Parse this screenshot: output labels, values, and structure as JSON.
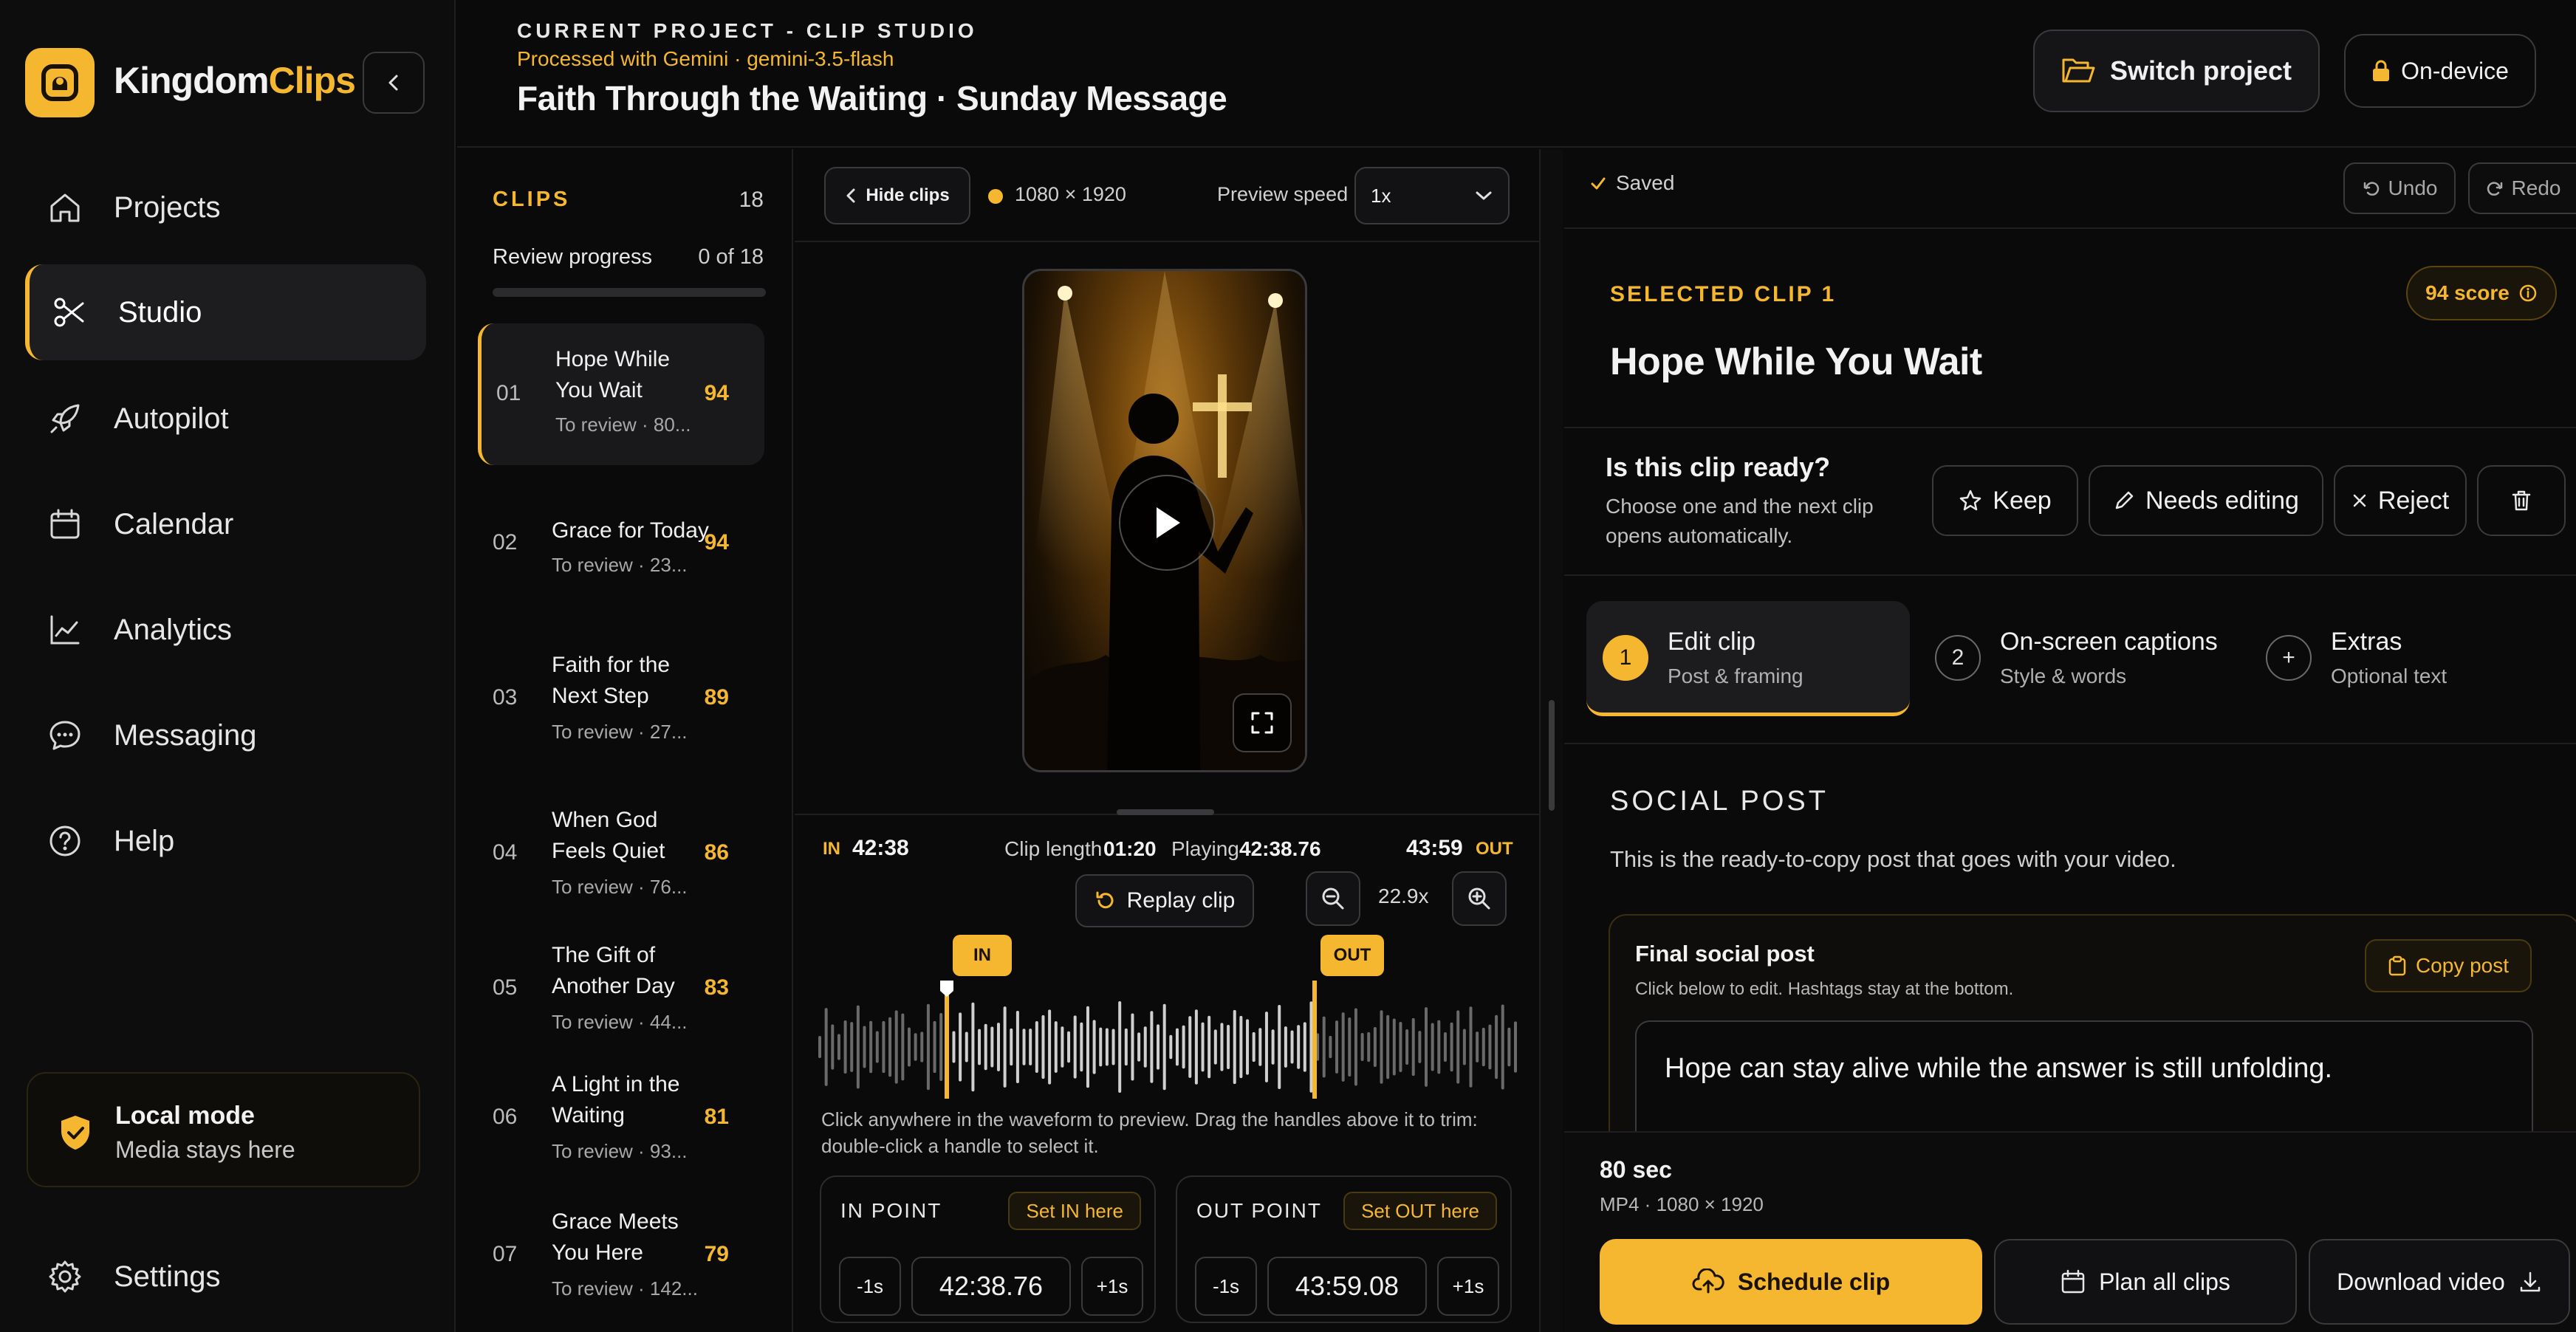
{
  "brand": {
    "name_part1": "Kingdom",
    "name_part2": "Clips",
    "accent": "#f5b72f"
  },
  "nav": {
    "items": [
      {
        "label": "Projects",
        "icon": "home-icon"
      },
      {
        "label": "Studio",
        "icon": "scissors-icon",
        "active": true
      },
      {
        "label": "Autopilot",
        "icon": "rocket-icon"
      },
      {
        "label": "Calendar",
        "icon": "calendar-icon"
      },
      {
        "label": "Analytics",
        "icon": "chart-icon"
      },
      {
        "label": "Messaging",
        "icon": "chat-icon"
      },
      {
        "label": "Help",
        "icon": "help-icon"
      }
    ],
    "settings": "Settings"
  },
  "local_mode": {
    "title": "Local mode",
    "subtitle": "Media stays here"
  },
  "header": {
    "eyebrow": "CURRENT PROJECT - CLIP STUDIO",
    "processed": "Processed with Gemini · gemini-3.5-flash",
    "title": "Faith Through the Waiting · Sunday Message",
    "switch_project": "Switch project",
    "on_device": "On-device"
  },
  "clips": {
    "heading": "CLIPS",
    "count": "18",
    "review_label": "Review progress",
    "review_value": "0 of 18",
    "review_fraction": 0,
    "items": [
      {
        "num": "01",
        "title": "Hope While You Wait",
        "sub": "To review · 80...",
        "score": "94",
        "selected": true
      },
      {
        "num": "02",
        "title": "Grace for Today",
        "sub": "To review · 23...",
        "score": "94"
      },
      {
        "num": "03",
        "title": "Faith for the Next Step",
        "sub": "To review · 27...",
        "score": "89"
      },
      {
        "num": "04",
        "title": "When God Feels Quiet",
        "sub": "To review · 76...",
        "score": "86"
      },
      {
        "num": "05",
        "title": "The Gift of Another Day",
        "sub": "To review · 44...",
        "score": "83"
      },
      {
        "num": "06",
        "title": "A Light in the Waiting",
        "sub": "To review · 93...",
        "score": "81"
      },
      {
        "num": "07",
        "title": "Grace Meets You Here",
        "sub": "To review · 142...",
        "score": "79"
      }
    ]
  },
  "preview": {
    "hide_clips": "Hide clips",
    "resolution": "1080 × 1920",
    "speed_label": "Preview speed",
    "speed_value": "1x"
  },
  "timeline": {
    "in_label": "IN",
    "in_time": "42:38",
    "clip_length_label": "Clip length",
    "clip_length": "01:20",
    "playing_label": "Playing",
    "playing": "42:38.76",
    "out_time": "43:59",
    "out_label": "OUT",
    "replay": "Replay clip",
    "zoom": "22.9x",
    "in_tag": "IN",
    "out_tag": "OUT",
    "hint": "Click anywhere in the waveform to preview. Drag the handles above it to trim: double-click a handle to select it."
  },
  "in_point": {
    "label": "IN POINT",
    "set": "Set IN here",
    "minus": "-1s",
    "value": "42:38.76",
    "plus": "+1s"
  },
  "out_point": {
    "label": "OUT POINT",
    "set": "Set OUT here",
    "minus": "-1s",
    "value": "43:59.08",
    "plus": "+1s"
  },
  "right": {
    "saved": "Saved",
    "undo": "Undo",
    "redo": "Redo",
    "selected_label": "SELECTED CLIP 1",
    "score": "94 score",
    "clip_title": "Hope While You Wait",
    "ready_title": "Is this clip ready?",
    "ready_sub": "Choose one and the next clip opens automatically.",
    "keep": "Keep",
    "needs_editing": "Needs editing",
    "reject": "Reject",
    "steps": [
      {
        "num": "1",
        "title": "Edit clip",
        "sub": "Post & framing",
        "active": true
      },
      {
        "num": "2",
        "title": "On-screen captions",
        "sub": "Style & words"
      },
      {
        "num": "+",
        "title": "Extras",
        "sub": "Optional text"
      }
    ],
    "social_heading": "SOCIAL POST",
    "social_sub": "This is the ready-to-copy post that goes with your video.",
    "final_title": "Final social post",
    "final_sub": "Click below to edit. Hashtags stay at the bottom.",
    "copy_post": "Copy post",
    "post_text": "Hope can stay alive while the answer is still unfolding.",
    "duration": "80 sec",
    "format": "MP4 · 1080 × 1920",
    "schedule": "Schedule clip",
    "plan_all": "Plan all clips",
    "download": "Download video"
  }
}
